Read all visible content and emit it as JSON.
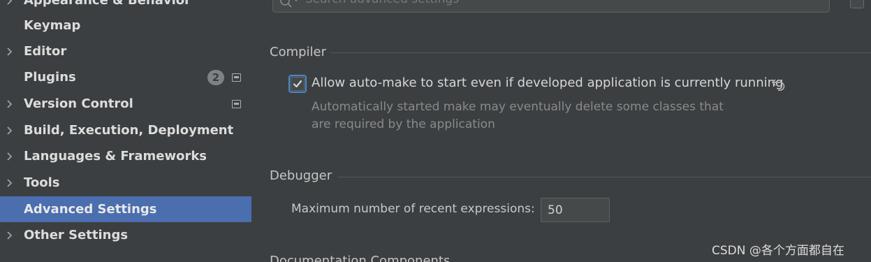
{
  "sidebar": {
    "items": [
      {
        "label": "Appearance & Behavior",
        "expandable": true
      },
      {
        "label": "Keymap",
        "expandable": false
      },
      {
        "label": "Editor",
        "expandable": true
      },
      {
        "label": "Plugins",
        "expandable": false,
        "badge": "2"
      },
      {
        "label": "Version Control",
        "expandable": true
      },
      {
        "label": "Build, Execution, Deployment",
        "expandable": true
      },
      {
        "label": "Languages & Frameworks",
        "expandable": true
      },
      {
        "label": "Tools",
        "expandable": true
      },
      {
        "label": "Advanced Settings",
        "expandable": false,
        "selected": true
      },
      {
        "label": "Other Settings",
        "expandable": true
      }
    ]
  },
  "main": {
    "search": {
      "placeholder": "Search advanced settings"
    },
    "sections": {
      "compiler": {
        "title": "Compiler",
        "option": {
          "label": "Allow auto-make to start even if developed application is currently running",
          "checked": true,
          "description_line1": "Automatically started make may eventually delete some classes that",
          "description_line2": "are required by the application"
        }
      },
      "debugger": {
        "title": "Debugger",
        "field_label": "Maximum number of recent expressions:",
        "field_value": "50"
      },
      "next": {
        "title": "Documentation Components"
      }
    }
  },
  "watermark": "CSDN @各个方面都自在",
  "colors": {
    "background": "#3c3f41",
    "selection": "#4b6eaf",
    "checkbox_focus": "#4a88c7"
  }
}
